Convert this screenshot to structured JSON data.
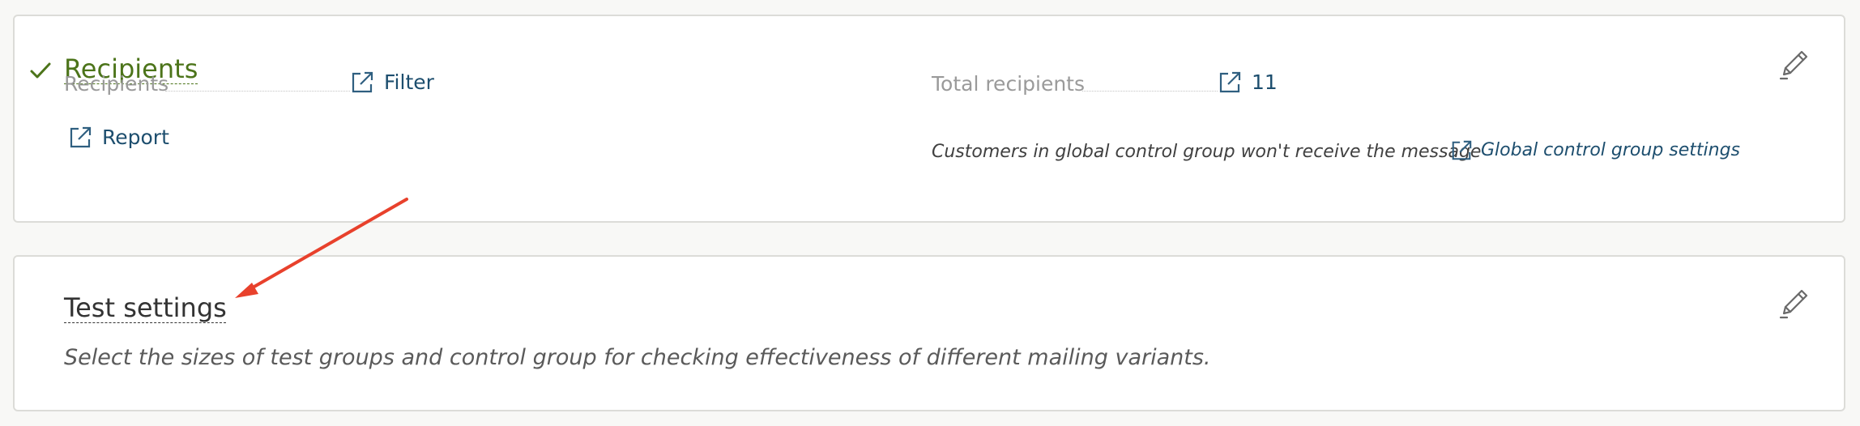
{
  "recipients_section": {
    "title": "Recipients",
    "recipients_label": "Recipients",
    "filter_link": "Filter",
    "report_link": "Report",
    "total_label": "Total recipients",
    "total_value": "11",
    "control_group_note": "Customers in global control group won't receive the message",
    "control_group_link": "Global control group settings"
  },
  "test_section": {
    "title": "Test settings",
    "description": "Select the sizes of test groups and control group for checking effectiveness of different mailing variants."
  },
  "colors": {
    "success_green": "#4c741a",
    "link_blue": "#1d4e6e",
    "annotation_arrow": "#e8412c"
  },
  "icons": {
    "completed": "check-icon",
    "edit": "pencil-edit-icon",
    "open": "external-link-icon"
  }
}
